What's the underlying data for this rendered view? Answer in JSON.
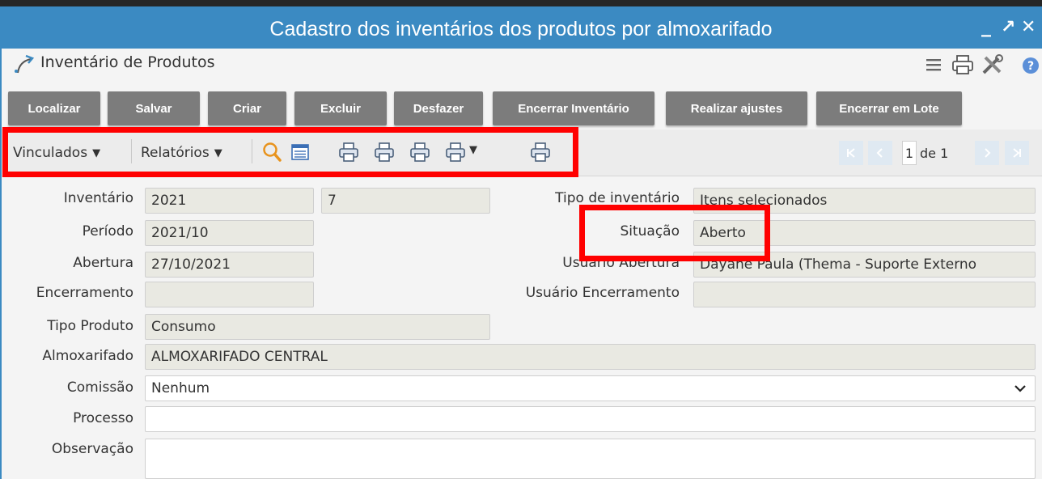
{
  "window": {
    "title": "Cadastro dos inventários dos produtos por almoxarifado",
    "controls": [
      "_",
      "↗",
      "✕"
    ]
  },
  "header": {
    "title": "Inventário de Produtos",
    "icons": [
      "menu-icon",
      "print-icon",
      "tools-icon",
      "help-icon"
    ]
  },
  "toolbar": {
    "buttons": [
      "Localizar",
      "Salvar",
      "Criar",
      "Excluir",
      "Desfazer",
      "Encerrar Inventário",
      "Realizar ajustes",
      "Encerrar em Lote"
    ]
  },
  "toolbar2": {
    "vinculados": "Vinculados",
    "relatorios": "Relatórios",
    "caret": "▼"
  },
  "pagination": {
    "current": "1",
    "of_label": "de 1"
  },
  "form": {
    "inventario_label": "Inventário",
    "inventario_year": "2021",
    "inventario_num": "7",
    "tipo_inventario_label": "Tipo de inventário",
    "tipo_inventario": "Itens selecionados",
    "periodo_label": "Período",
    "periodo": "2021/10",
    "situacao_label": "Situação",
    "situacao": "Aberto",
    "abertura_label": "Abertura",
    "abertura": "27/10/2021",
    "usuario_abertura_label": "Usuário Abertura",
    "usuario_abertura": "Dayane Paula (Thema - Suporte Externo",
    "encerramento_label": "Encerramento",
    "encerramento": "",
    "usuario_encerramento_label": "Usuário Encerramento",
    "usuario_encerramento": "",
    "tipo_produto_label": "Tipo Produto",
    "tipo_produto": "Consumo",
    "almoxarifado_label": "Almoxarifado",
    "almoxarifado": "ALMOXARIFADO CENTRAL",
    "comissao_label": "Comissão",
    "comissao": "Nenhum",
    "processo_label": "Processo",
    "processo": "",
    "observacao_label": "Observação",
    "observacao": ""
  },
  "colors": {
    "titlebar": "#3b8ac2",
    "button": "#7c7c7c",
    "highlight": "#ff0000",
    "readonly_field": "#e9e9e2"
  }
}
